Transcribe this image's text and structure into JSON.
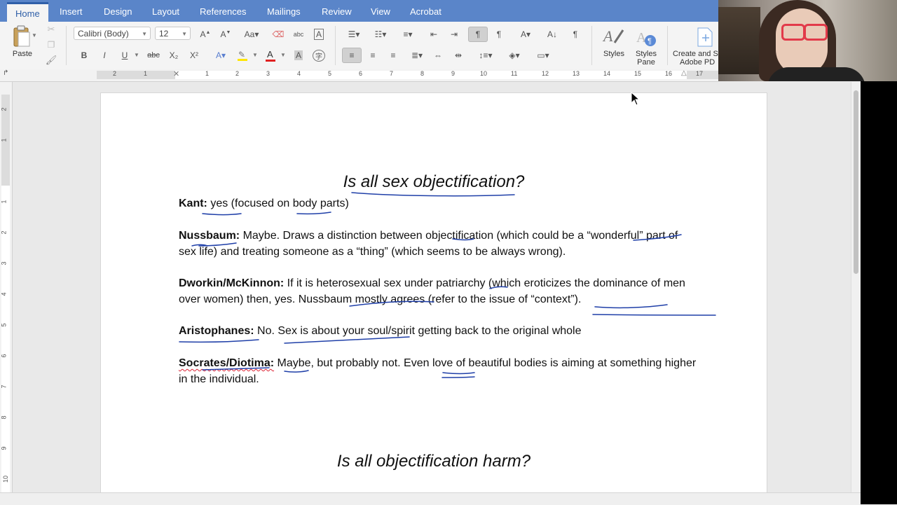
{
  "tabs": [
    "Home",
    "Insert",
    "Design",
    "Layout",
    "References",
    "Mailings",
    "Review",
    "View",
    "Acrobat"
  ],
  "active_tab": "Home",
  "ribbon": {
    "paste_label": "Paste",
    "font_name": "Calibri (Body)",
    "font_size": "12",
    "styles_label": "Styles",
    "styles_pane_label_1": "Styles",
    "styles_pane_label_2": "Pane",
    "create_label_1": "Create and S",
    "create_label_2": "Adobe PD",
    "bold": "B",
    "italic": "I",
    "underline": "U",
    "strike": "abc",
    "subscript": "X₂",
    "superscript": "X²"
  },
  "ruler": {
    "numbers": [
      "2",
      "1",
      "1",
      "2",
      "3",
      "4",
      "5",
      "6",
      "7",
      "8",
      "9",
      "10",
      "11",
      "12",
      "13",
      "14",
      "15",
      "16",
      "17"
    ]
  },
  "vruler": {
    "numbers": [
      "2",
      "1",
      "1",
      "2",
      "3",
      "4",
      "5",
      "6",
      "7",
      "8",
      "9",
      "10"
    ]
  },
  "document": {
    "heading1": "Is all sex objectification?",
    "heading2": "Is all objectification harm?",
    "paragraphs": [
      {
        "name": "Kant:",
        "text": " yes (focused on body parts)"
      },
      {
        "name": "Nussbaum:",
        "text": " Maybe. Draws a distinction between objectification (which could be a “wonderful” part of sex life) and treating someone as a “thing” (which seems to be always wrong)."
      },
      {
        "name": "Dworkin/McKinnon:",
        "text": " If it is heterosexual sex under patriarchy (which eroticizes the dominance of men over women) then, yes. Nussbaum mostly agrees (refer to the issue of “context”)."
      },
      {
        "name": "Aristophanes:",
        "text": " No. Sex is about your soul/spirit getting back to the original whole"
      },
      {
        "name": "Socrates/Diotima:",
        "text": " Maybe, but probably not. Even love of beautiful bodies is aiming at something higher in the individual."
      }
    ]
  },
  "colors": {
    "tabbar": "#5a85c9",
    "ink": "#1f3fa8",
    "spelling": "#d22233",
    "font_color_bar": "#e02020",
    "highlight_bar": "#ffe600"
  }
}
